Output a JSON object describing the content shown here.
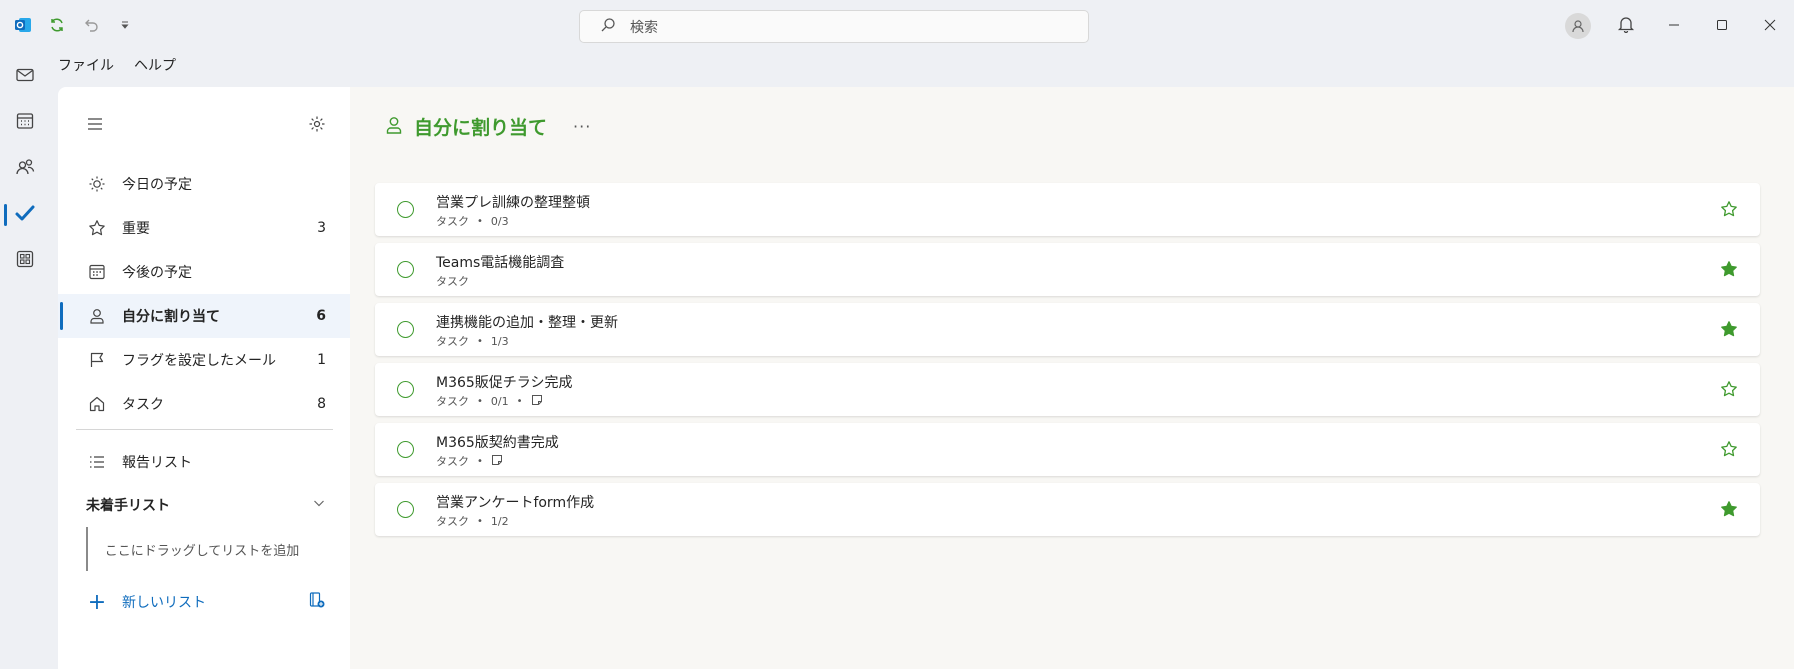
{
  "search": {
    "placeholder": "検索"
  },
  "menu": {
    "file": "ファイル",
    "help": "ヘルプ"
  },
  "nav": [
    {
      "label": "今日の予定",
      "count": "",
      "icon": "sun-icon"
    },
    {
      "label": "重要",
      "count": "3",
      "icon": "star-icon"
    },
    {
      "label": "今後の予定",
      "count": "",
      "icon": "calendar-icon"
    },
    {
      "label": "自分に割り当て",
      "count": "6",
      "icon": "person-icon",
      "active": true
    },
    {
      "label": "フラグを設定したメール",
      "count": "1",
      "icon": "flag-icon"
    },
    {
      "label": "タスク",
      "count": "8",
      "icon": "home-icon"
    }
  ],
  "lists": {
    "report_list": "報告リスト",
    "group_title": "未着手リスト",
    "drop_hint": "ここにドラッグしてリストを追加",
    "new_list": "新しいリスト"
  },
  "main": {
    "title": "自分に割り当て",
    "more": "···"
  },
  "tasks": [
    {
      "title": "営業プレ訓練の整理整頓",
      "list": "タスク",
      "progress": "0/3",
      "note": false,
      "important": false
    },
    {
      "title": "Teams電話機能調査",
      "list": "タスク",
      "progress": "",
      "note": false,
      "important": true
    },
    {
      "title": "連携機能の追加・整理・更新",
      "list": "タスク",
      "progress": "1/3",
      "note": false,
      "important": true
    },
    {
      "title": "M365販促チラシ完成",
      "list": "タスク",
      "progress": "0/1",
      "note": true,
      "important": false
    },
    {
      "title": "M365版契約書完成",
      "list": "タスク",
      "progress": "",
      "note": true,
      "important": false
    },
    {
      "title": "営業アンケートform作成",
      "list": "タスク",
      "progress": "1/2",
      "note": false,
      "important": true
    }
  ],
  "colors": {
    "accent": "#3f9a2e",
    "brand": "#0f6cbd"
  }
}
